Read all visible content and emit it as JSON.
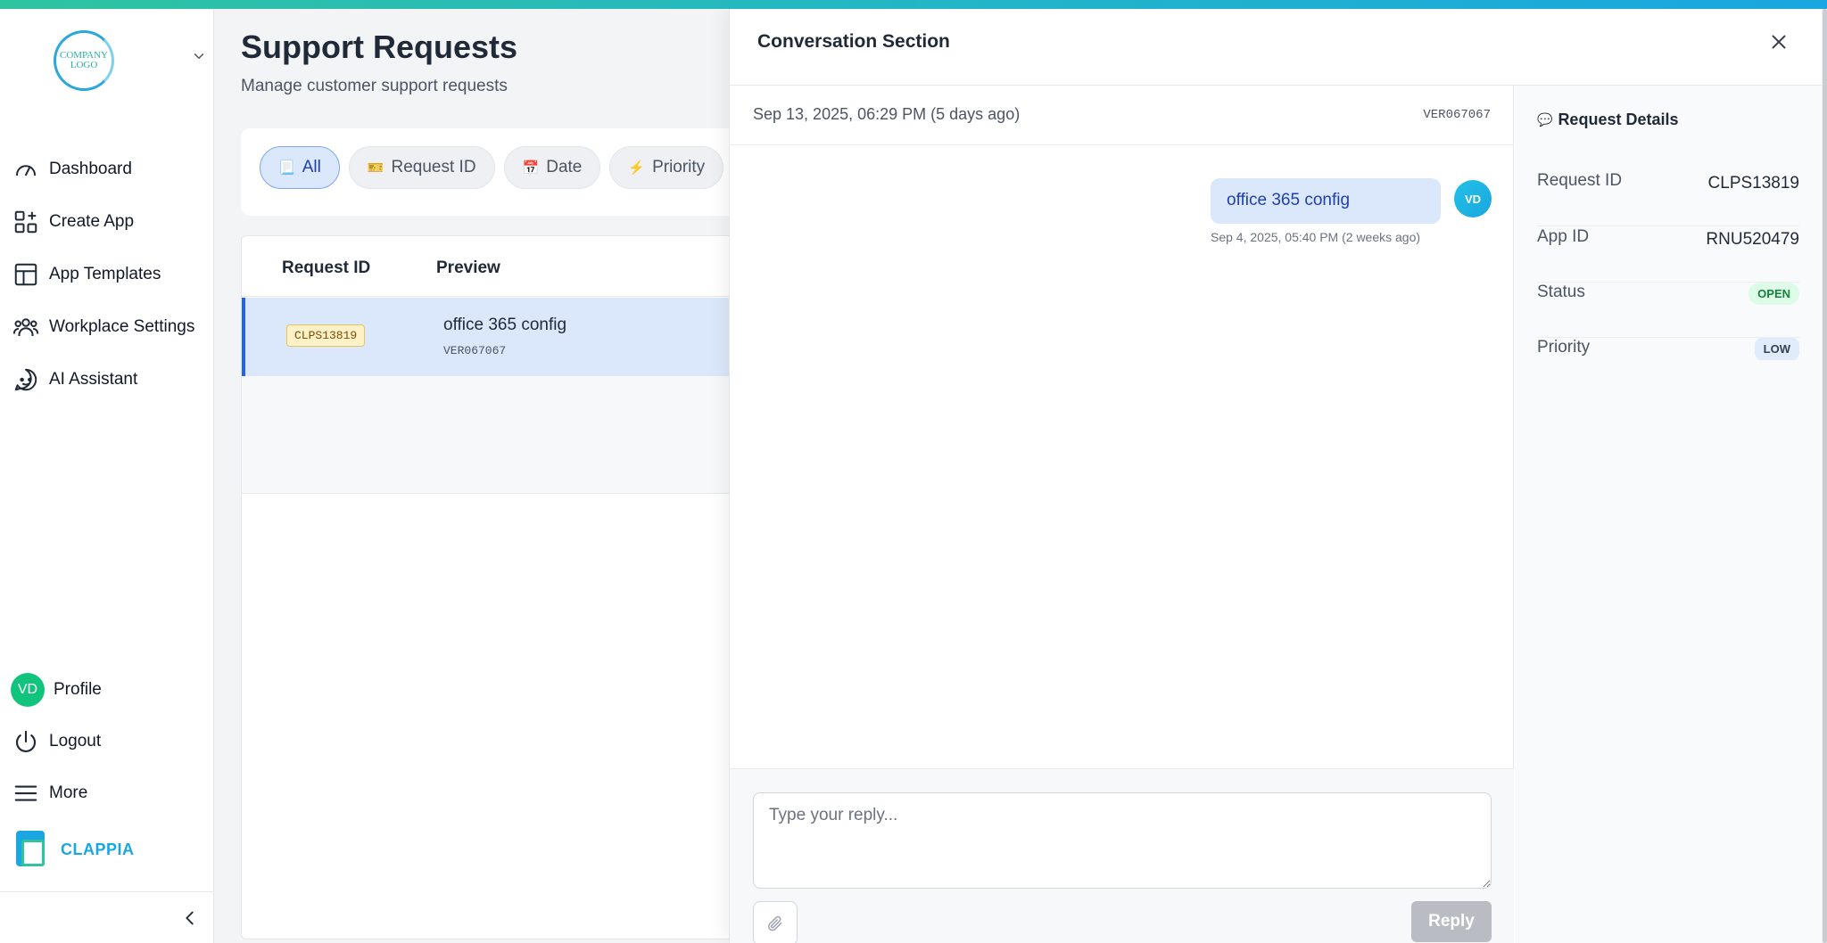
{
  "sidebar": {
    "logo_text": "COMPANY LOGO",
    "items": [
      {
        "label": "Dashboard",
        "icon": "dashboard-icon"
      },
      {
        "label": "Create App",
        "icon": "create-app-icon"
      },
      {
        "label": "App Templates",
        "icon": "templates-icon"
      },
      {
        "label": "Workplace Settings",
        "icon": "users-icon"
      },
      {
        "label": "AI Assistant",
        "icon": "ai-chat-icon"
      }
    ],
    "profile": {
      "initials": "VD",
      "label": "Profile"
    },
    "logout_label": "Logout",
    "more_label": "More",
    "brand_name": "CLAPPIA"
  },
  "main": {
    "title": "Support Requests",
    "subtitle": "Manage customer support requests",
    "filters": [
      {
        "icon": "📃",
        "label": "All",
        "active": true
      },
      {
        "icon": "🎫",
        "label": "Request ID",
        "active": false
      },
      {
        "icon": "📅",
        "label": "Date",
        "active": false
      },
      {
        "icon": "⚡",
        "label": "Priority",
        "active": false
      }
    ],
    "table": {
      "columns": [
        "Request ID",
        "Preview"
      ],
      "rows": [
        {
          "id": "CLPS13819",
          "title": "office 365 config",
          "sub": "VER067067",
          "selected": true
        }
      ]
    }
  },
  "drawer": {
    "title": "Conversation Section",
    "meta_date": "Sep 13, 2025, 06:29 PM (5 days ago)",
    "meta_id": "VER067067",
    "messages": [
      {
        "text": "office 365 config",
        "time": "Sep 4, 2025, 05:40 PM (2 weeks ago)",
        "avatar": "VD"
      }
    ],
    "reply_placeholder": "Type your reply...",
    "reply_button": "Reply",
    "details": {
      "heading": "Request Details",
      "heading_icon": "💬",
      "request_id_label": "Request ID",
      "request_id": "CLPS13819",
      "app_id_label": "App ID",
      "app_id": "RNU520479",
      "status_label": "Status",
      "status": "OPEN",
      "priority_label": "Priority",
      "priority": "LOW"
    }
  },
  "colors": {
    "accent": "#1aa6e0",
    "selected_row": "#dbe7fb",
    "primary_blue": "#2563eb",
    "status_open": "#15803d"
  }
}
